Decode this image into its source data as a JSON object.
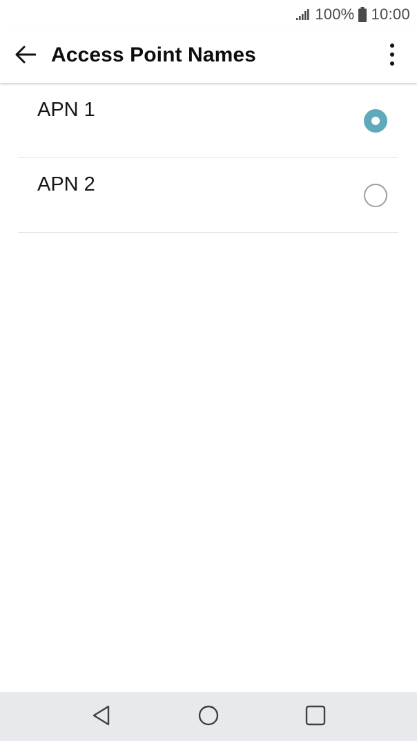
{
  "status_bar": {
    "battery": "100%",
    "time": "10:00",
    "icons": [
      "signal-icon",
      "battery-icon"
    ]
  },
  "toolbar": {
    "title": "Access Point Names",
    "back_icon": "arrow-left-icon",
    "menu_icon": "more-vert-icon"
  },
  "apn_list": [
    {
      "label": "APN 1",
      "selected": true
    },
    {
      "label": "APN 2",
      "selected": false
    }
  ],
  "nav_bar": {
    "icons": [
      "nav-back-icon",
      "nav-home-icon",
      "nav-recents-icon"
    ]
  },
  "colors": {
    "accent": "#5eaabb",
    "nav_bar": "#e8e9ec",
    "divider": "#e2e2e2"
  }
}
